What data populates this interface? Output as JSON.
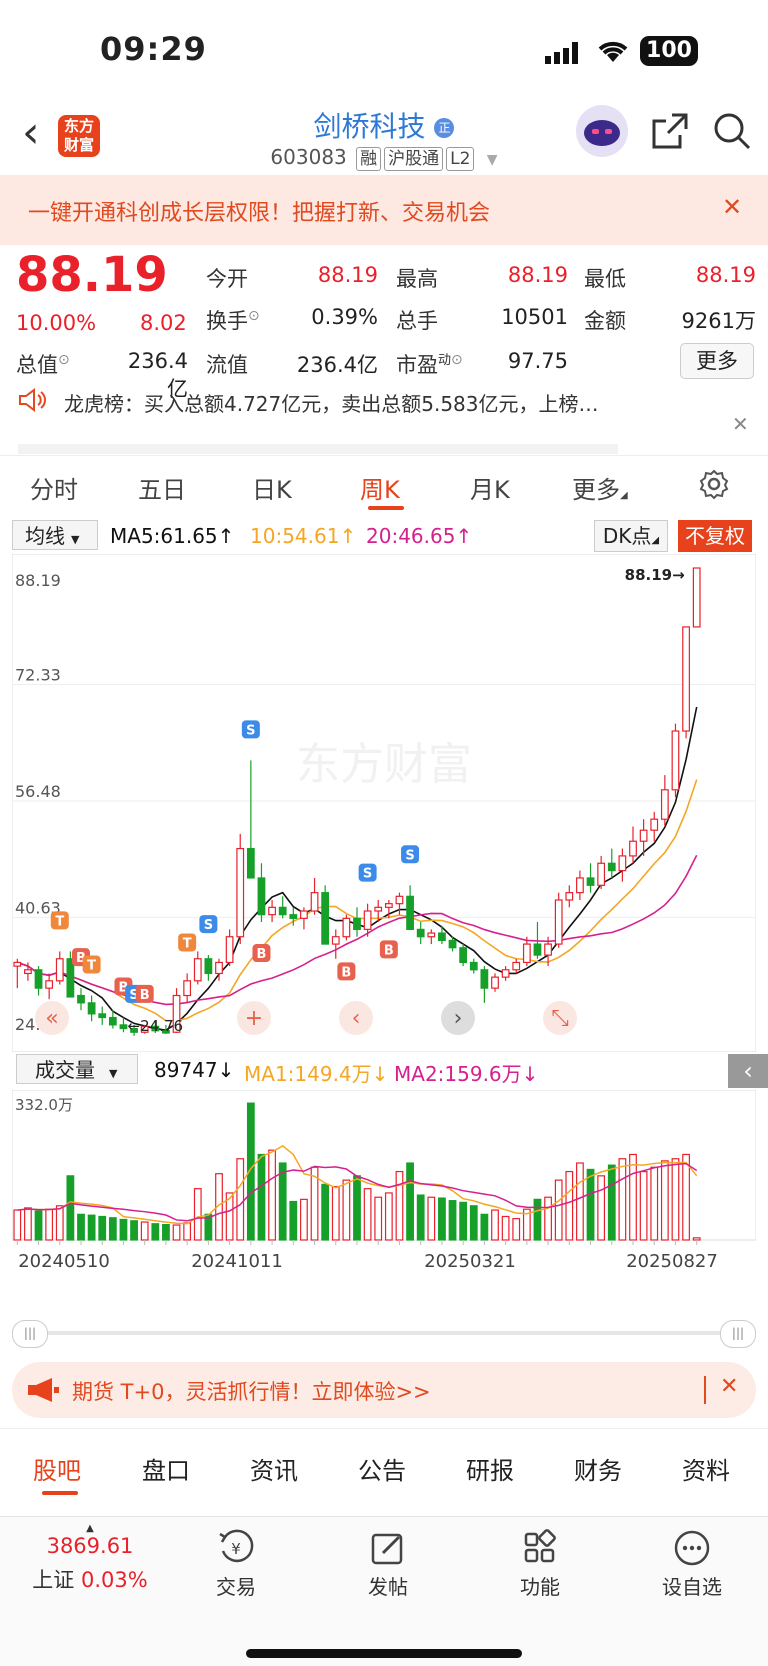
{
  "status_bar": {
    "time": "09:29",
    "battery": "100"
  },
  "header": {
    "back": "‹",
    "logo_line1": "东方",
    "logo_line2": "财富",
    "title": "剑桥科技",
    "title_badge": "正",
    "code": "603083",
    "tags": [
      "融",
      "沪股通",
      "L2"
    ]
  },
  "promo_banner": {
    "text": "一键开通科创成长层权限！把握打新、交易机会",
    "close": "✕"
  },
  "quote": {
    "price": "88.19",
    "change_pct": "10.00%",
    "change_abs": "8.02",
    "open_label": "今开",
    "open": "88.19",
    "high_label": "最高",
    "high": "88.19",
    "low_label": "最低",
    "low": "88.19",
    "turnover_label": "换手",
    "turnover": "0.39%",
    "volume_label": "总手",
    "volume": "10501",
    "amount_label": "金额",
    "amount": "9261万",
    "mktcap_label": "总值",
    "mktcap": "236.4亿",
    "float_label": "流值",
    "float": "236.4亿",
    "pe_label": "市盈",
    "pe_sup": "动",
    "pe": "97.75",
    "more": "更多"
  },
  "news": {
    "line1": "龙虎榜：买入总额4.727亿元，卖出总额5.583亿元，上榜…",
    "close": "✕"
  },
  "period_tabs": [
    "分时",
    "五日",
    "日K",
    "周K",
    "月K",
    "更多"
  ],
  "active_tab": "周K",
  "kline_legend": {
    "selector": "均线",
    "ma5": "MA5:61.65",
    "ma10": "10:54.61",
    "ma20": "20:46.65",
    "dk": "DK点",
    "fq": "不复权"
  },
  "chart_data": {
    "type": "candlestick",
    "y_ticks": [
      "88.19",
      "72.33",
      "56.48",
      "40.63",
      "24.76"
    ],
    "ylim": [
      24.76,
      88.19
    ],
    "last_label": "88.19",
    "low_label": "24.76",
    "x_labels": [
      "20240510",
      "20241011",
      "20250321",
      "20250827"
    ],
    "candles": [
      [
        34,
        35,
        31,
        34.5
      ],
      [
        33,
        34.5,
        32,
        33.5
      ],
      [
        33.5,
        34,
        30,
        31
      ],
      [
        31,
        33,
        29.5,
        32
      ],
      [
        32,
        36,
        31.5,
        35
      ],
      [
        35,
        36,
        30,
        29.8
      ],
      [
        30,
        31,
        28,
        29
      ],
      [
        29,
        30,
        26.5,
        27.5
      ],
      [
        27.5,
        28.5,
        26,
        27
      ],
      [
        27,
        28,
        25.5,
        26
      ],
      [
        26,
        27,
        25,
        25.5
      ],
      [
        25.5,
        26,
        24.5,
        25
      ],
      [
        25,
        26,
        24.8,
        25.8
      ],
      [
        25.8,
        26.5,
        24.9,
        25.2
      ],
      [
        25.2,
        26,
        24.76,
        24.9
      ],
      [
        25,
        31,
        24.9,
        30
      ],
      [
        30,
        33,
        29,
        32
      ],
      [
        32,
        36,
        31.5,
        35
      ],
      [
        35,
        35.5,
        32,
        33
      ],
      [
        33,
        35,
        32,
        34.5
      ],
      [
        34.5,
        39,
        34,
        38
      ],
      [
        38,
        52,
        37,
        50
      ],
      [
        50,
        62,
        48,
        46
      ],
      [
        46,
        48,
        40,
        41
      ],
      [
        41,
        43,
        40,
        42
      ],
      [
        42,
        43.5,
        40.5,
        41
      ],
      [
        41,
        42,
        39.5,
        40.5
      ],
      [
        40.5,
        42,
        39,
        41.5
      ],
      [
        41.5,
        46,
        41,
        44
      ],
      [
        44,
        45,
        39,
        37
      ],
      [
        37,
        39,
        35,
        38
      ],
      [
        38,
        41,
        37.5,
        40.5
      ],
      [
        40.5,
        42,
        38,
        39
      ],
      [
        39,
        42.5,
        38,
        41.5
      ],
      [
        41.5,
        43,
        40,
        42
      ],
      [
        42,
        43,
        40.5,
        42.5
      ],
      [
        42.5,
        44,
        41,
        43.5
      ],
      [
        43.5,
        45,
        40,
        39
      ],
      [
        39,
        40,
        37,
        38
      ],
      [
        38,
        39,
        37,
        38.5
      ],
      [
        38.5,
        39.5,
        37,
        37.5
      ],
      [
        37.5,
        38,
        36,
        36.5
      ],
      [
        36.5,
        37,
        34,
        34.5
      ],
      [
        34.5,
        35,
        33,
        33.5
      ],
      [
        33.5,
        34,
        29,
        31
      ],
      [
        31,
        33,
        30.5,
        32.5
      ],
      [
        32.5,
        34,
        32,
        33.5
      ],
      [
        33.5,
        35,
        33,
        34.5
      ],
      [
        34.5,
        38,
        34,
        37
      ],
      [
        37,
        40,
        35,
        35.5
      ],
      [
        35.5,
        38,
        34,
        37
      ],
      [
        37,
        44,
        36.5,
        43
      ],
      [
        43,
        45,
        42,
        44
      ],
      [
        44,
        47,
        43,
        46
      ],
      [
        46,
        48,
        44,
        45
      ],
      [
        45,
        49,
        44.5,
        48
      ],
      [
        48,
        50,
        46,
        47
      ],
      [
        47,
        50,
        45.5,
        49
      ],
      [
        49,
        53,
        48,
        51
      ],
      [
        51,
        54,
        49,
        52.5
      ],
      [
        52.5,
        55,
        51,
        54
      ],
      [
        54,
        60,
        53,
        58
      ],
      [
        58,
        67,
        57,
        66
      ],
      [
        66,
        80,
        65,
        80.17
      ],
      [
        80.17,
        88.19,
        80.17,
        88.19
      ]
    ],
    "ma_lines": [
      "MA5",
      "MA10",
      "MA20"
    ],
    "signals": [
      {
        "i": 4,
        "t": "T",
        "up": true
      },
      {
        "i": 6,
        "t": "B",
        "up": true
      },
      {
        "i": 7,
        "t": "T",
        "up": true
      },
      {
        "i": 10,
        "t": "B",
        "up": true
      },
      {
        "i": 11,
        "t": "S",
        "up": true
      },
      {
        "i": 12,
        "t": "B",
        "up": true
      },
      {
        "i": 16,
        "t": "T",
        "up": true
      },
      {
        "i": 18,
        "t": "S",
        "up": true
      },
      {
        "i": 22,
        "t": "S",
        "up": true
      },
      {
        "i": 23,
        "t": "B",
        "up": false
      },
      {
        "i": 31,
        "t": "B",
        "up": false
      },
      {
        "i": 33,
        "t": "S",
        "up": true
      },
      {
        "i": 35,
        "t": "B",
        "up": false
      },
      {
        "i": 37,
        "t": "S",
        "up": true
      }
    ],
    "volume": {
      "selector": "成交量",
      "value": "89747",
      "ma1": "MA1:149.4万",
      "ma2": "MA2:159.6万",
      "max_label": "332.0万"
    },
    "volumes": [
      70,
      75,
      68,
      72,
      80,
      150,
      60,
      58,
      55,
      52,
      48,
      45,
      42,
      38,
      36,
      35,
      40,
      120,
      60,
      155,
      110,
      190,
      320,
      200,
      210,
      180,
      90,
      95,
      170,
      130,
      125,
      140,
      150,
      120,
      100,
      110,
      160,
      180,
      105,
      100,
      98,
      92,
      88,
      80,
      60,
      70,
      55,
      50,
      72,
      95,
      100,
      140,
      160,
      180,
      165,
      150,
      175,
      190,
      200,
      160,
      170,
      185,
      190,
      200,
      5
    ],
    "volume_ylim": [
      0,
      332
    ]
  },
  "promo2": {
    "text": "期货 T+0，灵活抓行情！立即体验>>",
    "close": "✕"
  },
  "bottom_tabs": [
    "股吧",
    "盘口",
    "资讯",
    "公告",
    "研报",
    "财务",
    "资料"
  ],
  "bottom_active": "股吧",
  "bottom_nav": {
    "index_value": "3869.61",
    "index_name": "上证",
    "index_change": "0.03%",
    "items": [
      "交易",
      "发帖",
      "功能",
      "设自选"
    ]
  }
}
